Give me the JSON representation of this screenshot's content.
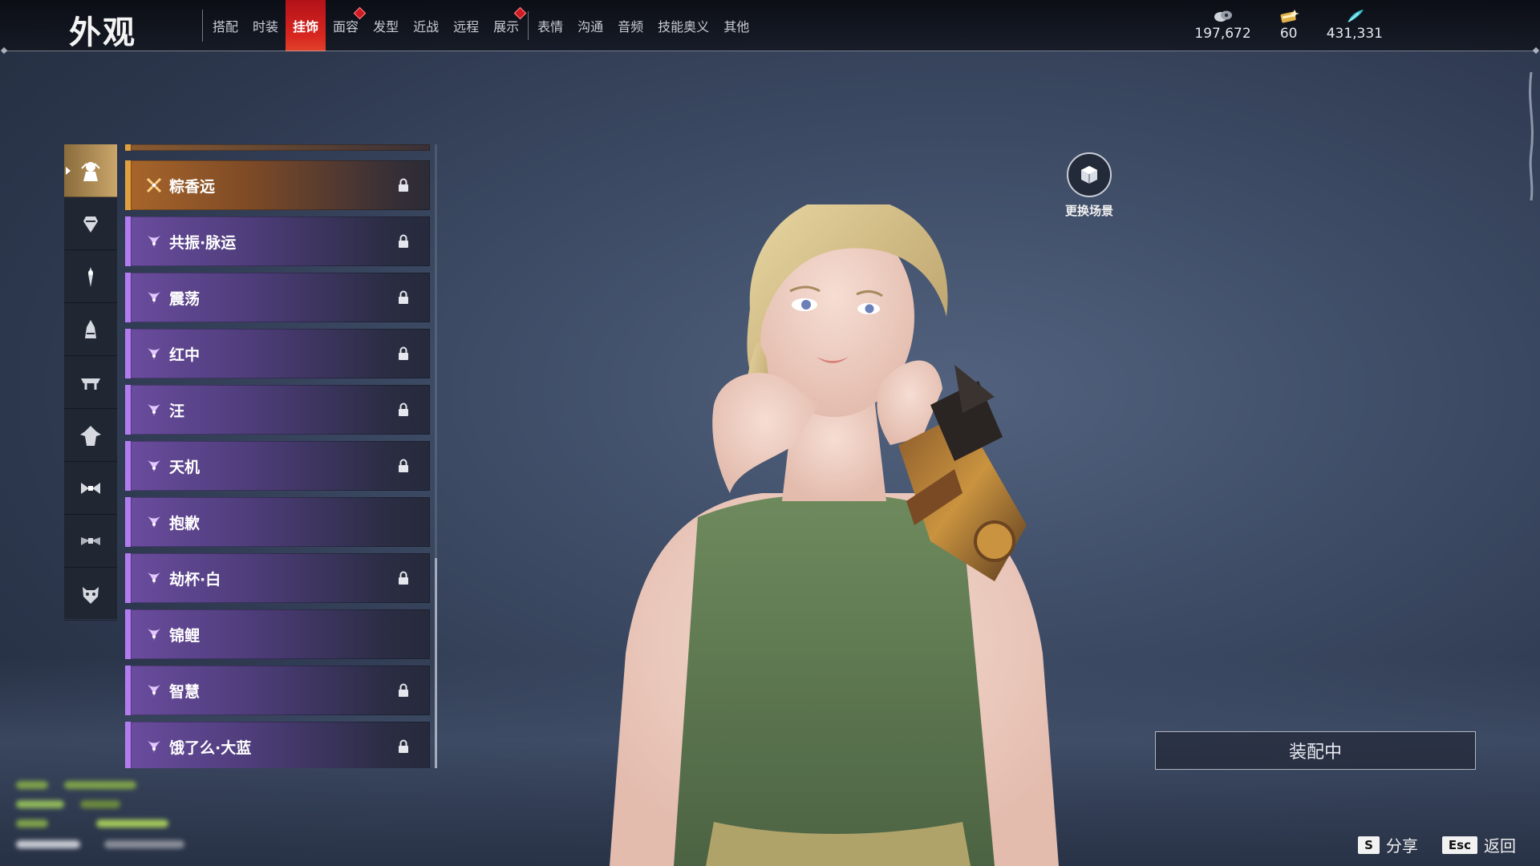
{
  "header": {
    "title": "外观",
    "tabs": [
      {
        "label": "搭配",
        "active": false,
        "badge": false
      },
      {
        "label": "时装",
        "active": false,
        "badge": false
      },
      {
        "label": "挂饰",
        "active": true,
        "badge": false
      },
      {
        "label": "面容",
        "active": false,
        "badge": true
      },
      {
        "label": "发型",
        "active": false,
        "badge": false
      },
      {
        "label": "近战",
        "active": false,
        "badge": false
      },
      {
        "label": "远程",
        "active": false,
        "badge": false
      },
      {
        "label": "展示",
        "active": false,
        "badge": true
      },
      {
        "label": "表情",
        "active": false,
        "badge": false
      },
      {
        "label": "沟通",
        "active": false,
        "badge": false
      },
      {
        "label": "音频",
        "active": false,
        "badge": false
      },
      {
        "label": "技能奥义",
        "active": false,
        "badge": false
      },
      {
        "label": "其他",
        "active": false,
        "badge": false
      }
    ],
    "currencies": [
      {
        "icon": "coin-icon",
        "value": "197,672"
      },
      {
        "icon": "ticket-icon",
        "value": "60"
      },
      {
        "icon": "feather-icon",
        "value": "431,331"
      }
    ]
  },
  "rail": {
    "items": [
      {
        "icon": "ornament-head-icon",
        "active": true
      },
      {
        "icon": "waist-pendant-icon",
        "active": false
      },
      {
        "icon": "hairpin-icon",
        "active": false
      },
      {
        "icon": "back-ornament-icon",
        "active": false
      },
      {
        "icon": "shoulder-icon",
        "active": false
      },
      {
        "icon": "cape-icon",
        "active": false
      },
      {
        "icon": "bow-icon",
        "active": false
      },
      {
        "icon": "mask-ribbon-icon",
        "active": false
      },
      {
        "icon": "demon-mask-icon",
        "active": false
      }
    ]
  },
  "list": {
    "items": [
      {
        "name": "粽香远",
        "rarity": "gold",
        "locked": true
      },
      {
        "name": "共振·脉运",
        "rarity": "purple",
        "locked": true
      },
      {
        "name": "震荡",
        "rarity": "purple",
        "locked": true
      },
      {
        "name": "红中",
        "rarity": "purple",
        "locked": true
      },
      {
        "name": "汪",
        "rarity": "purple",
        "locked": true
      },
      {
        "name": "天机",
        "rarity": "purple",
        "locked": true
      },
      {
        "name": "抱歉",
        "rarity": "purple",
        "locked": false
      },
      {
        "name": "劫杯·白",
        "rarity": "purple",
        "locked": true
      },
      {
        "name": "锦鲤",
        "rarity": "purple",
        "locked": false
      },
      {
        "name": "智慧",
        "rarity": "purple",
        "locked": true
      },
      {
        "name": "饿了么·大蓝",
        "rarity": "purple",
        "locked": true
      }
    ]
  },
  "scene": {
    "label": "更换场景"
  },
  "equip": {
    "label": "装配中"
  },
  "hints": [
    {
      "key": "S",
      "label": "分享"
    },
    {
      "key": "Esc",
      "label": "返回"
    }
  ],
  "colors": {
    "tab_active": "#d7261f",
    "rarity_gold": "#e0a03e",
    "rarity_purple": "#b27cf0",
    "rail_active": "#caa66a"
  }
}
